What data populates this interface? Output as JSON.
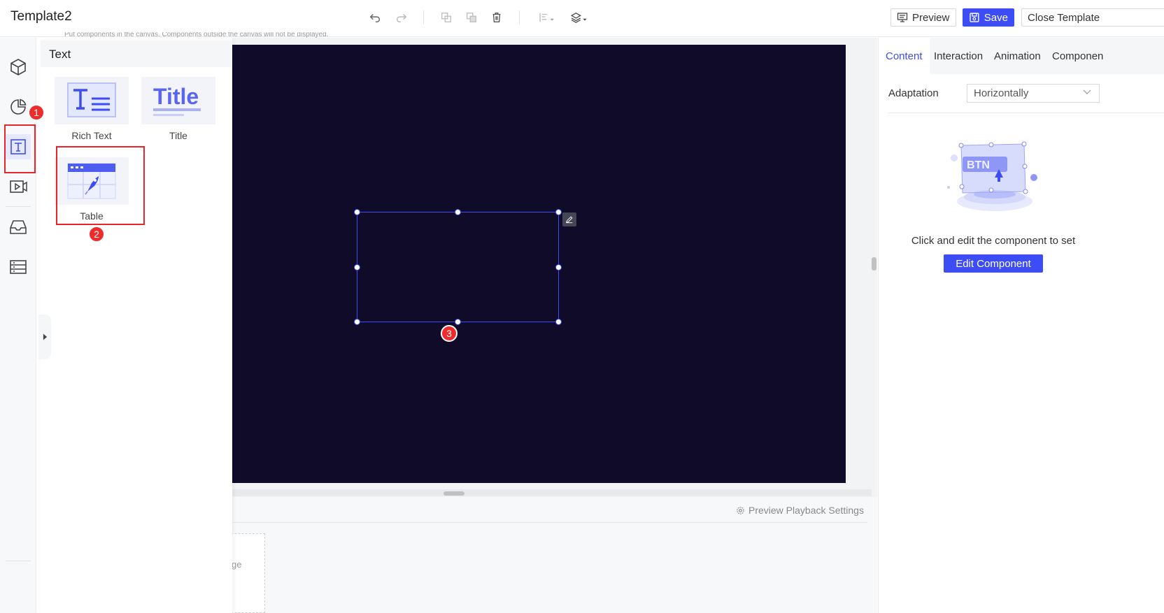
{
  "app": {
    "title": "Template2"
  },
  "toolbar": {
    "preview_label": "Preview",
    "save_label": "Save",
    "close_label": "Close Template"
  },
  "leftbar": {
    "items": [
      "3d-component",
      "chart",
      "text",
      "media",
      "inbox",
      "data-list"
    ],
    "active": "text"
  },
  "component_panel": {
    "title": "Text",
    "items": [
      {
        "label": "Rich Text",
        "icon": "rich-text-icon"
      },
      {
        "label": "Title",
        "icon": "title-icon"
      },
      {
        "label": "Table",
        "icon": "table-icon"
      }
    ]
  },
  "canvas": {
    "hint": "Put components in the canvas. Components outside the canvas will not be displayed.",
    "background": "#0f0b29"
  },
  "bottom": {
    "playback_label": "Preview Playback Settings",
    "page_card_text": "ge"
  },
  "right_panel": {
    "tabs": [
      "Content",
      "Interaction",
      "Animation",
      "Componen"
    ],
    "active_tab": "Content",
    "adaptation_label": "Adaptation",
    "adaptation_value": "Horizontally",
    "message": "Click and edit the component to set",
    "edit_button": "Edit Component",
    "illustration_text": "BTN"
  },
  "annotations": {
    "badge1": "1",
    "badge2": "2",
    "badge3": "3"
  },
  "colors": {
    "accent": "#3d4df5",
    "annotation_red": "#e8262a"
  }
}
